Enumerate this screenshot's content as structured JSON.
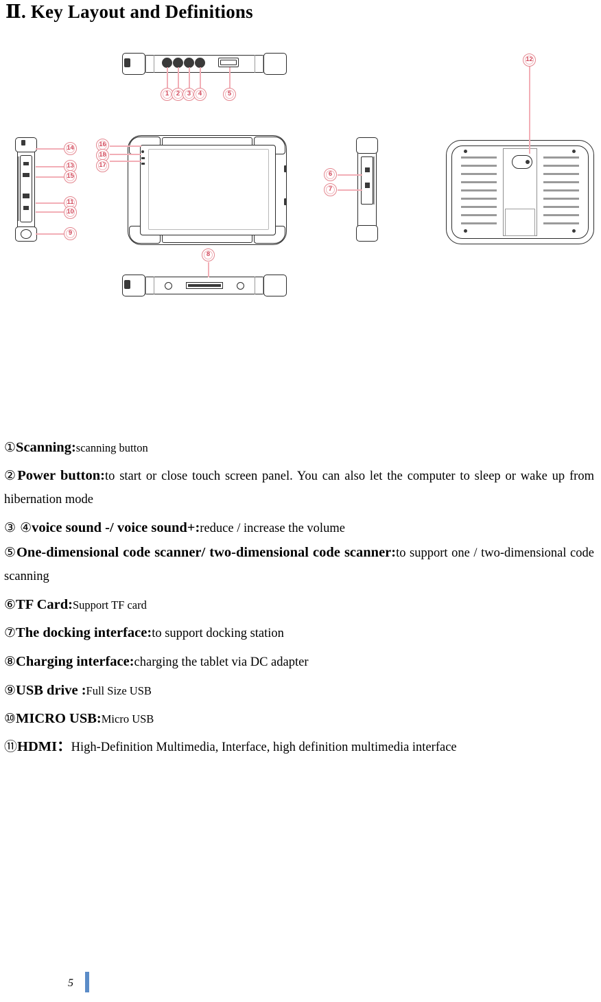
{
  "title": "Ⅱ. Key Layout and Definitions",
  "figure": {
    "caption": "Exploded key-layout drawings of a rugged tablet: top edge view, left edge view, front view, right edge view, back view and bottom edge view, each annotated with numbered red callout bubbles.",
    "callouts": {
      "top_view": [
        "1",
        "2",
        "3",
        "4",
        "5"
      ],
      "left_view": [
        "14",
        "13",
        "15",
        "11",
        "10",
        "9"
      ],
      "front_view": [
        "16",
        "18",
        "17"
      ],
      "right_view": [
        "6",
        "7"
      ],
      "back_view": [
        "12"
      ],
      "bottom_view": [
        "8"
      ]
    },
    "callout_color": "#d24a5c",
    "leader_color": "#f2aeb6",
    "outline_color": "#2b2b2b"
  },
  "definitions": [
    {
      "num": "①",
      "term": "Scanning:",
      "desc": "scanning button",
      "desc_size": "small"
    },
    {
      "num": "②",
      "term": "Power button:",
      "desc": "to start or close touch screen panel. You can also let the computer to sleep or wake up from hibernation mode",
      "desc_size": "normal"
    },
    {
      "num": "③ ④",
      "term": "voice sound -/ voice sound+:",
      "desc": "reduce / increase the volume",
      "desc_size": "normal"
    },
    {
      "num": "⑤",
      "term": "One-dimensional code scanner/ two-dimensional code scanner:",
      "desc": "to support one / two-dimensional code scanning",
      "desc_size": "normal"
    },
    {
      "num": "⑥",
      "term": "TF Card:",
      "desc": "Support TF card",
      "desc_size": "small"
    },
    {
      "num": "⑦",
      "term": "The docking interface:",
      "desc": "to support docking station",
      "desc_size": "normal"
    },
    {
      "num": "⑧",
      "term": "Charging interface:",
      "desc": "charging the tablet via DC adapter",
      "desc_size": "normal"
    },
    {
      "num": "⑨",
      "term": "USB drive :",
      "desc": "Full Size USB",
      "desc_size": "small"
    },
    {
      "num": "⑩",
      "term": "MICRO USB:",
      "desc": "Micro USB",
      "desc_size": "small"
    },
    {
      "num": "⑪",
      "term": "HDMI：",
      "desc": "High-Definition Multimedia, Interface, high definition multimedia interface",
      "desc_size": "normal"
    }
  ],
  "footer": {
    "page_number": "5",
    "caret_color": "#5b8cc8"
  }
}
